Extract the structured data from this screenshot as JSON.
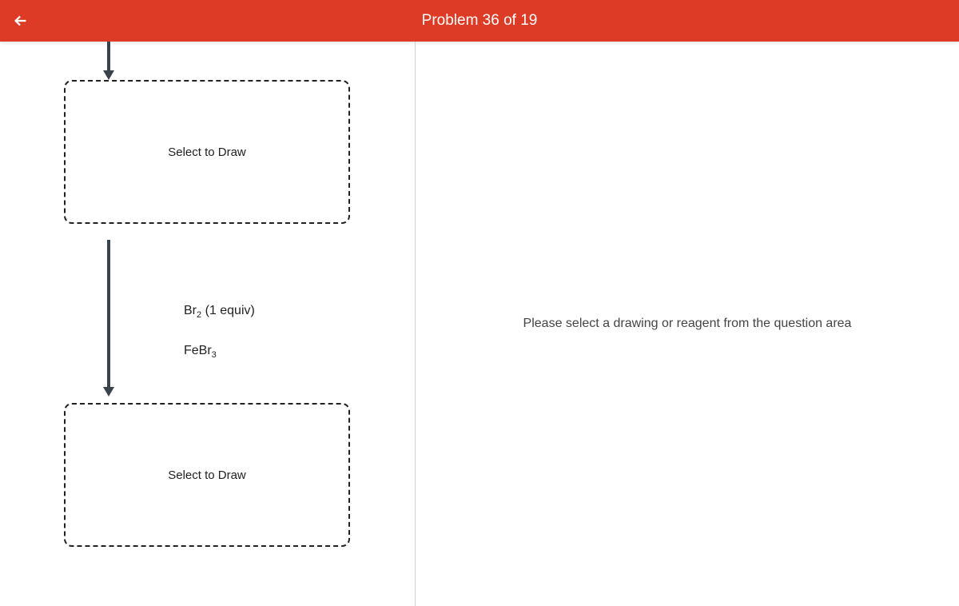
{
  "header": {
    "title": "Problem 36 of 19"
  },
  "left": {
    "drawBox1": "Select to Draw",
    "drawBox2": "Select to Draw",
    "reagent1_prefix": "Br",
    "reagent1_sub": "2",
    "reagent1_suffix": " (1 equiv)",
    "reagent2_prefix": "FeBr",
    "reagent2_sub": "3"
  },
  "right": {
    "message": "Please select a drawing or reagent from the question area"
  }
}
